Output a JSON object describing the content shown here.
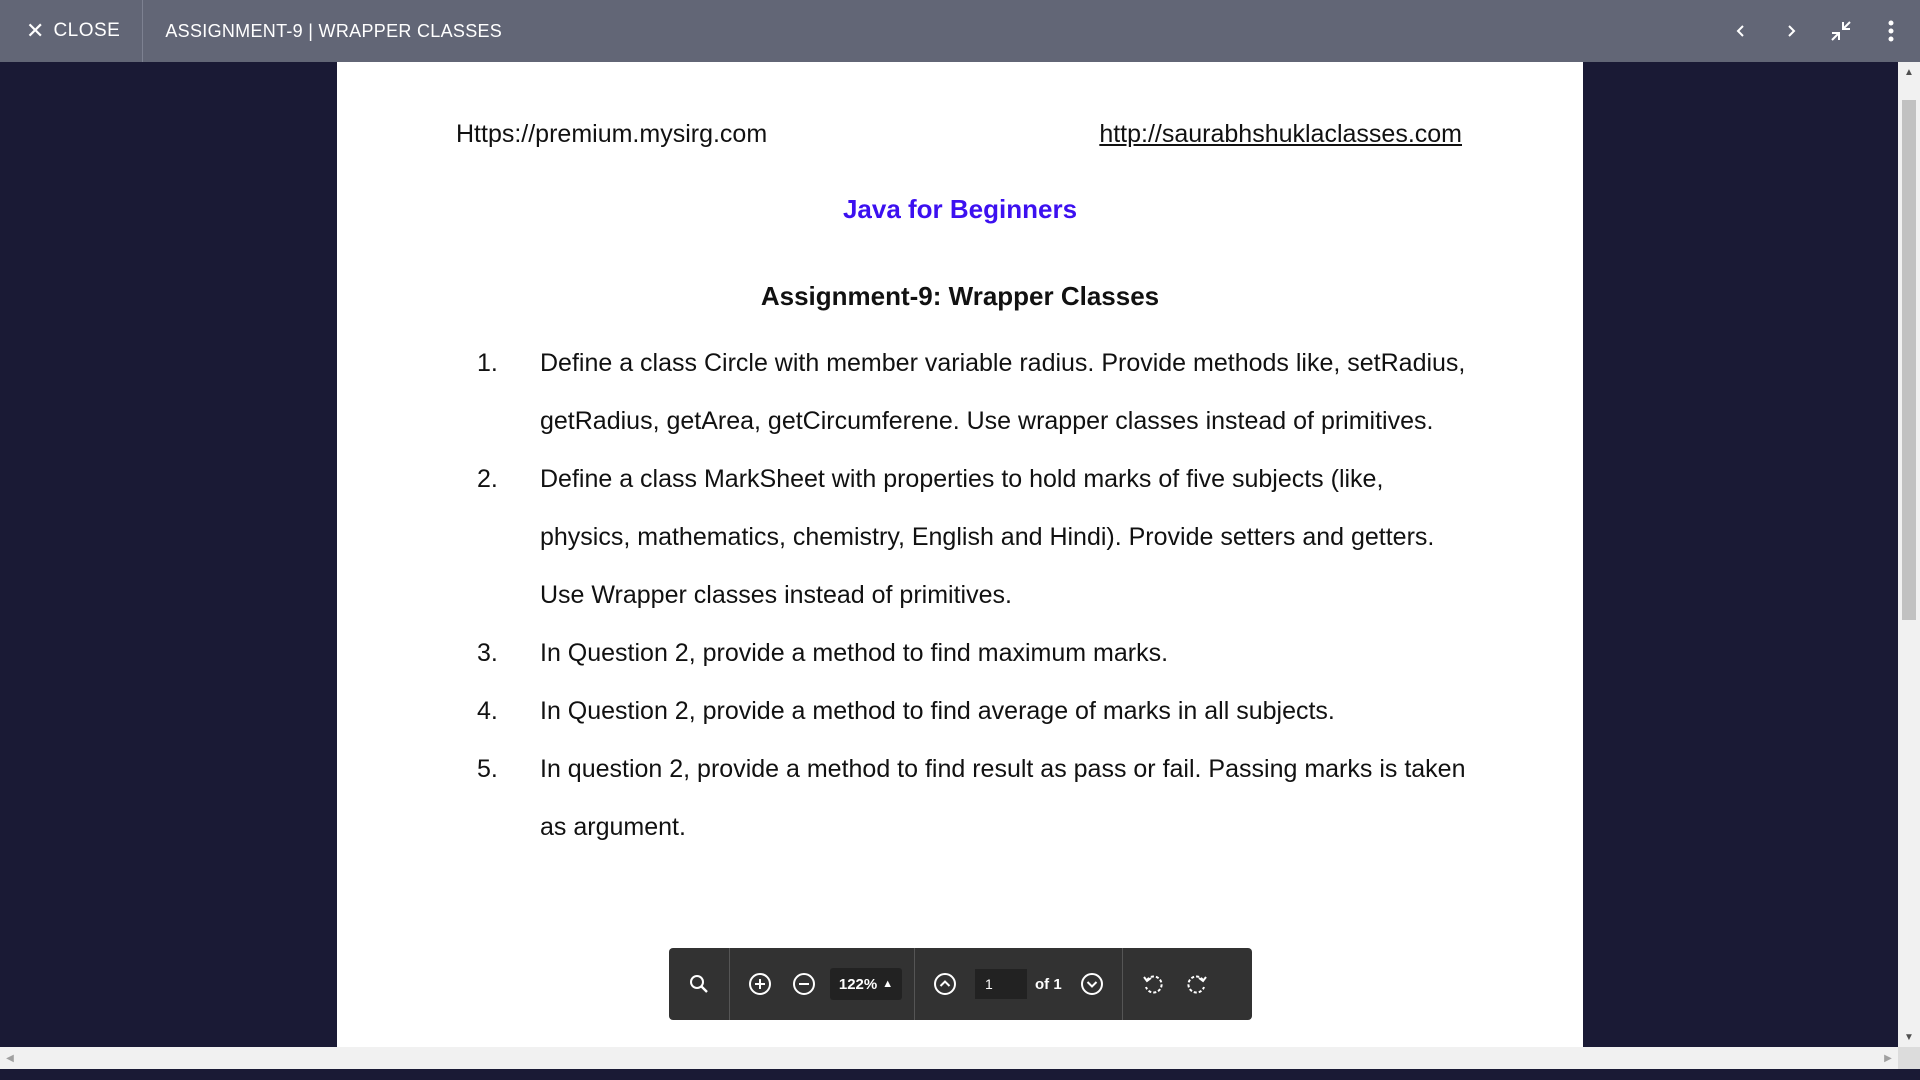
{
  "topbar": {
    "close_label": "CLOSE",
    "title": "ASSIGNMENT-9 | WRAPPER CLASSES",
    "icons": [
      "close-icon",
      "chevron-left-icon",
      "chevron-right-icon",
      "exit-fullscreen-icon",
      "more-vert-icon"
    ]
  },
  "document": {
    "header_left": "Https://premium.mysirg.com",
    "header_right": "http://saurabhshuklaclasses.com",
    "subject": "Java for Beginners",
    "heading": "Assignment-9: Wrapper Classes",
    "questions": [
      {
        "num": "1.",
        "lines": [
          "Define a class Circle with member variable radius. Provide methods like, setRadius,",
          "getRadius, getArea, getCircumferene. Use wrapper classes instead of primitives."
        ]
      },
      {
        "num": "2.",
        "lines": [
          "Define a class MarkSheet with properties to hold marks of five subjects (like,",
          "physics, mathematics, chemistry, English and Hindi). Provide setters and getters.",
          "Use Wrapper classes instead of primitives."
        ]
      },
      {
        "num": "3.",
        "lines": [
          "In Question 2, provide a method to find maximum marks."
        ]
      },
      {
        "num": "4.",
        "lines": [
          "In Question 2, provide a method to find average of marks in all subjects."
        ]
      },
      {
        "num": "5.",
        "lines": [
          "In question 2, provide a method to find result as pass or fail. Passing marks is taken",
          "as argument."
        ]
      }
    ]
  },
  "viewer_toolbar": {
    "zoom": "122%",
    "page_value": "1",
    "page_of": "of 1"
  },
  "colors": {
    "topbar": "#626676",
    "background": "#1a1a35",
    "subject": "#3c10f0",
    "toolbar": "#323232"
  }
}
